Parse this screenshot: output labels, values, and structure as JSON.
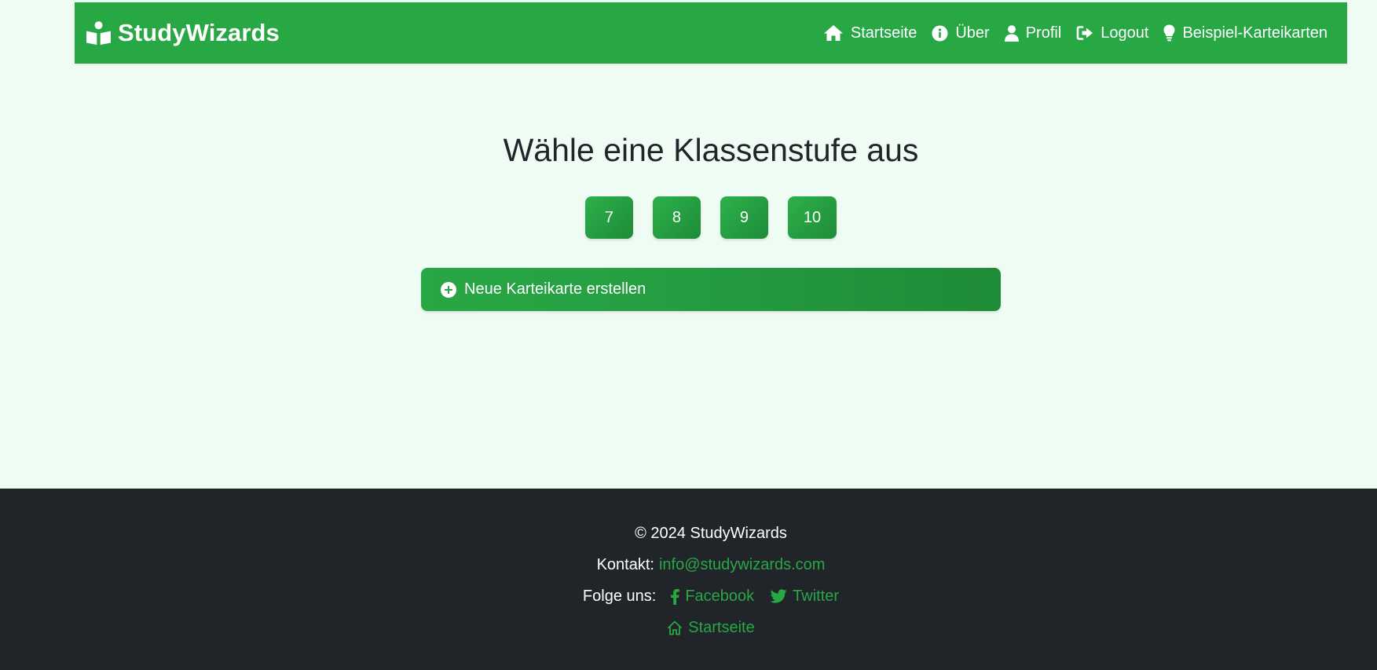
{
  "navbar": {
    "brand": "StudyWizards",
    "brand_icon": "book-reader-icon",
    "links": [
      {
        "label": "Startseite",
        "icon": "home-icon"
      },
      {
        "label": "Über",
        "icon": "info-circle-icon"
      },
      {
        "label": "Profil",
        "icon": "user-icon"
      },
      {
        "label": "Logout",
        "icon": "sign-out-icon"
      },
      {
        "label": "Beispiel-Karteikarten",
        "icon": "lightbulb-icon"
      }
    ]
  },
  "main": {
    "heading": "Wähle eine Klassenstufe aus",
    "grades": [
      "7",
      "8",
      "9",
      "10"
    ],
    "new_card_button": {
      "label": "Neue Karteikarte erstellen",
      "icon": "plus-circle-icon"
    }
  },
  "footer": {
    "copyright": "© 2024 StudyWizards",
    "contact_label": "Kontakt:",
    "contact_email": "info@studywizards.com",
    "follow_label": "Folge uns:",
    "social": [
      {
        "label": "Facebook",
        "icon": "facebook-icon"
      },
      {
        "label": "Twitter",
        "icon": "twitter-icon"
      }
    ],
    "home_link": {
      "label": "Startseite",
      "icon": "home-outline-icon"
    }
  },
  "colors": {
    "primary": "#28a745",
    "page_background": "#effcf3",
    "footer_background": "#212529",
    "heading_text": "#212529"
  }
}
